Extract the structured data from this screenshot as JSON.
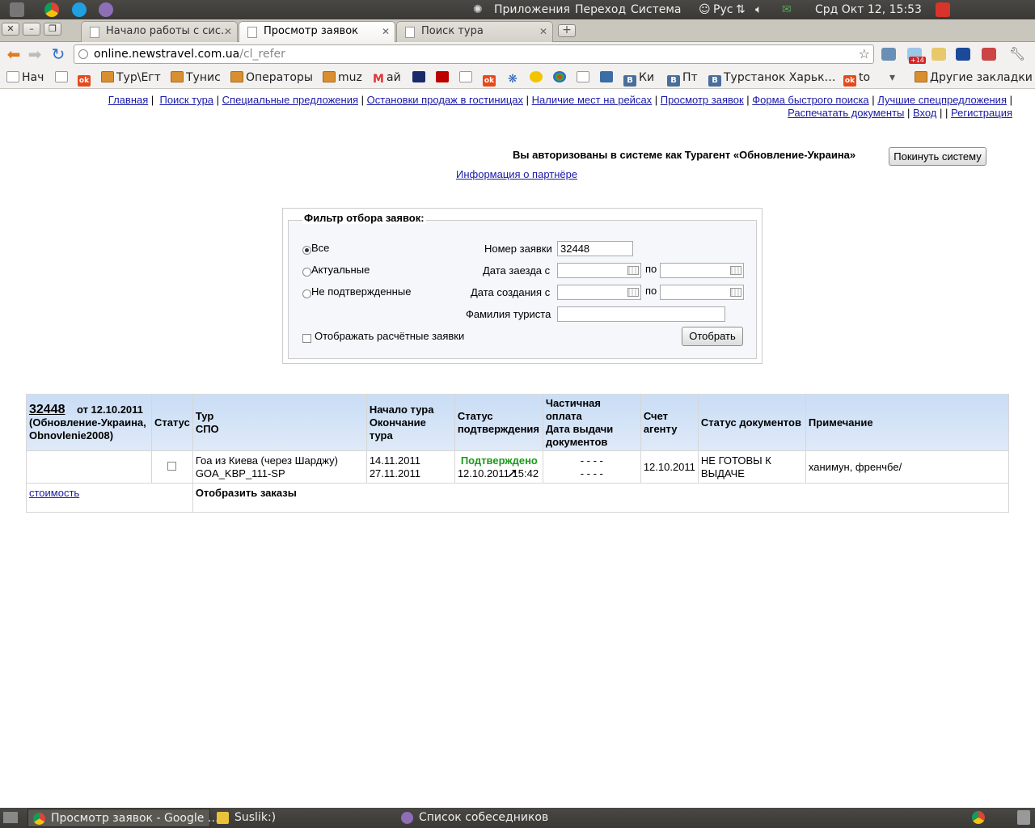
{
  "panel": {
    "apps": "Приложения",
    "places": "Переход",
    "system": "Система",
    "keyboard": "Рус",
    "clock": "Срд Окт 12, 15:53"
  },
  "tabs": [
    {
      "title": "Начало работы с сис…",
      "active": false
    },
    {
      "title": "Просмотр заявок",
      "active": true
    },
    {
      "title": "Поиск тура",
      "active": false
    }
  ],
  "address": {
    "host": "online.newstravel.com.ua",
    "path": "/cl_refer"
  },
  "ext_badge": "+14",
  "bookmarks": [
    "Нач",
    "Тур\\Егт",
    "Тунис",
    "Операторы",
    "muz",
    "ай",
    "Ки",
    "Пт",
    "Турстанок Харьк…",
    "to",
    "Другие закладки"
  ],
  "nav": {
    "home": "Главная",
    "tour_search": "Поиск тура",
    "special": "Специальные предложения",
    "hotel_stop": "Остановки продаж в гостиницах",
    "seats": "Наличие мест на рейсах",
    "orders_view": "Просмотр заявок",
    "quick_search": "Форма быстрого поиска",
    "best_offers": "Лучшие спецпредложения",
    "print_docs": "Распечатать документы",
    "login": "Вход",
    "register": "Регистрация"
  },
  "auth": {
    "text": "Вы авторизованы в системе как Турагент «Обновление-Украина»",
    "logout": "Покинуть систему",
    "partner_info": "Информация о партнёре"
  },
  "filter": {
    "title": "Фильтр отбора заявок:",
    "radio_all": "Все",
    "radio_actual": "Актуальные",
    "radio_unconfirmed": "Не подтвержденные",
    "order_number_label": "Номер заявки",
    "order_number_value": "32448",
    "arrival_from_label": "Дата заезда с",
    "created_from_label": "Дата создания с",
    "to_label": "по",
    "tourist_label": "Фамилия туриста",
    "show_calc": "Отображать расчётные заявки",
    "submit": "Отобрать"
  },
  "table": {
    "order_no": "32448",
    "order_from": "от 12.10.2011",
    "agent_line": "(Обновление-Украина, Obnovlenie2008)",
    "headers": {
      "status": "Статус",
      "tour": "Тур",
      "spo": "СПО",
      "start": "Начало тура",
      "end": "Окончание тура",
      "confirm_status": "Статус подтверждения",
      "partial": "Частичная оплата",
      "doc_date": "Дата выдачи документов",
      "invoice": "Счет агенту",
      "doc_status": "Статус документов",
      "note": "Примечание"
    },
    "row": {
      "tour": "Гоа из Киева (через Шарджу)",
      "spo": "GOA_KBP_111-SP",
      "start": "14.11.2011",
      "end": "27.11.2011",
      "confirm": "Подтверждено",
      "confirm_time": "12.10.2011 15:42",
      "partial": "- - - -",
      "doc_date": "- - - -",
      "invoice": "12.10.2011",
      "doc_status": "НЕ ГОТОВЫ К ВЫДАЧЕ",
      "note": "ханимун, френчбе/"
    },
    "cost_link": "стоимость",
    "show_orders": "Отобразить заказы"
  },
  "taskbar": [
    {
      "label": "Просмотр заявок - Google …",
      "active": true
    },
    {
      "label": "Suslik:)",
      "active": false
    },
    {
      "label": "Список собеседников",
      "active": false
    }
  ]
}
